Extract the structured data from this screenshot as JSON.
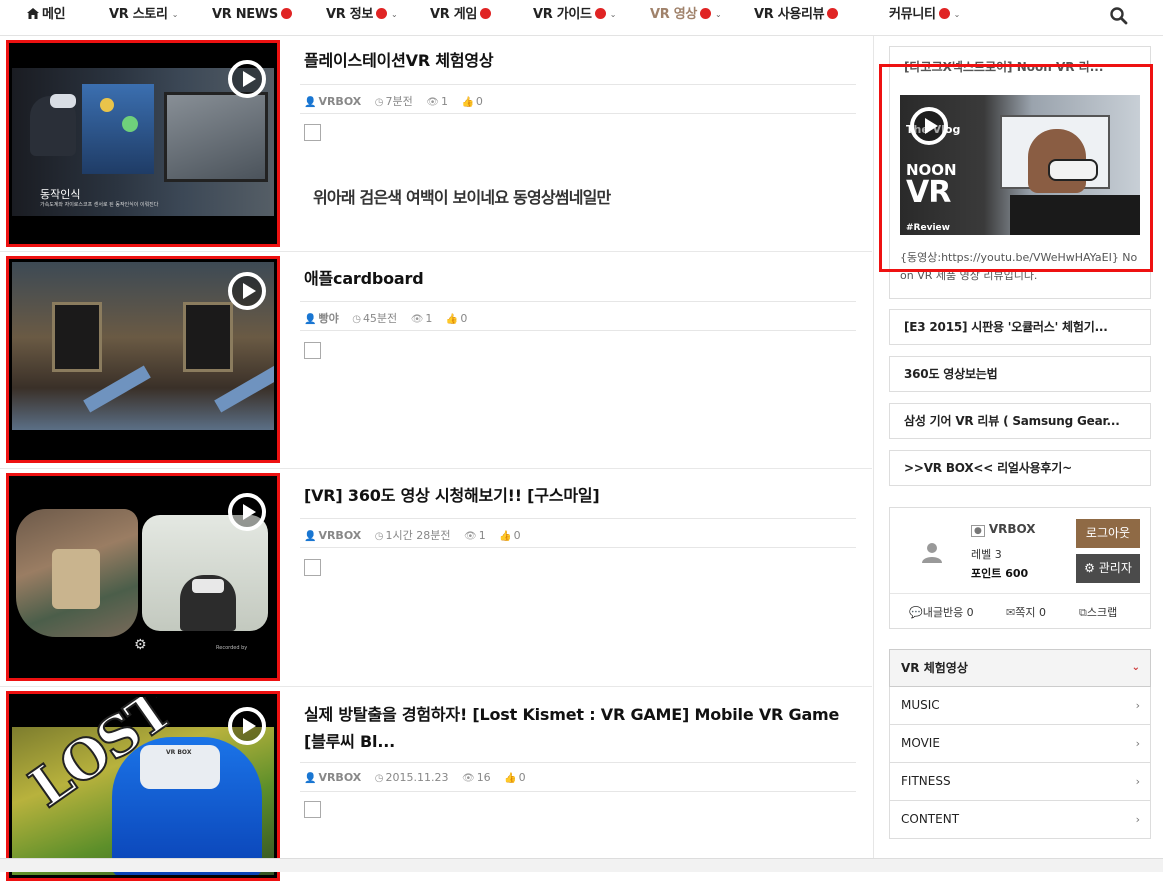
{
  "nav": {
    "items": [
      {
        "label": "메인",
        "dot": false,
        "chevron": false,
        "active": false
      },
      {
        "label": "VR 스토리",
        "dot": false,
        "chevron": true,
        "active": false
      },
      {
        "label": "VR NEWS",
        "dot": true,
        "chevron": false,
        "active": false
      },
      {
        "label": "VR 정보",
        "dot": true,
        "chevron": true,
        "active": false
      },
      {
        "label": "VR 게임",
        "dot": true,
        "chevron": false,
        "active": false
      },
      {
        "label": "VR 가이드",
        "dot": true,
        "chevron": true,
        "active": false
      },
      {
        "label": "VR 영상",
        "dot": true,
        "chevron": true,
        "active": true
      },
      {
        "label": "VR 사용리뷰",
        "dot": true,
        "chevron": false,
        "active": false
      },
      {
        "label": "커뮤니티",
        "dot": true,
        "chevron": true,
        "active": false
      }
    ],
    "active_color": "#a0826b",
    "dot_color": "#e02424",
    "search_icon": "search-icon"
  },
  "posts": [
    {
      "title": "플레이스테이션VR 체험영상",
      "author": "VRBOX",
      "time": "7분전",
      "views": "1",
      "likes": "0",
      "thumb_caption": "동작인식",
      "thumb_subcaption": "가속도계와 자이로스코프 센서로 된 동작인식이 이뤄진다"
    },
    {
      "title": "애플cardboard",
      "author": "빵야",
      "time": "45분전",
      "views": "1",
      "likes": "0"
    },
    {
      "title": "[VR] 360도 영상 시청해보기!! [구스마일]",
      "author": "VRBOX",
      "time": "1시간 28분전",
      "views": "1",
      "likes": "0",
      "thumb_watermark": "Recorded by"
    },
    {
      "title": "실제 방탈출을 경험하자! [Lost Kismet : VR GAME] Mobile VR Game [블루씨 Bl...",
      "author": "VRBOX",
      "time": "2015.11.23",
      "views": "16",
      "likes": "0",
      "thumb_lost": "LOST",
      "thumb_brand": "VR BOX"
    }
  ],
  "note_text": "위아래 검은색 여백이 보이네요 동영상썸네일만",
  "sidebar": {
    "feature": {
      "title": "[다코크X넥스트로이] Noon VR 리...",
      "image_text_top": "The Vlog",
      "image_text_logo1": "NOON",
      "image_text_logo2": "VR",
      "image_text_bottom": "#Review",
      "text": "{동영상:https://youtu.be/VWeHwHAYaEI} Noon VR 제품 영상 리뷰입니다."
    },
    "links": [
      "[E3 2015] 시판용 '오큘러스' 체험기...",
      "360도 영상보는법",
      "삼성 기어 VR 리뷰 ( Samsung Gear...",
      ">>VR BOX<< 리얼사용후기~"
    ],
    "user": {
      "name": "VRBOX",
      "level": "레벨 3",
      "points": "포인트 600",
      "logout": "로그아웃",
      "admin": "관리자",
      "comments": "내글반응 0",
      "messages": "쪽지 0",
      "scrap": "스크랩"
    },
    "category": {
      "header": "VR 체험영상",
      "items": [
        "MUSIC",
        "MOVIE",
        "FITNESS",
        "CONTENT"
      ]
    }
  }
}
